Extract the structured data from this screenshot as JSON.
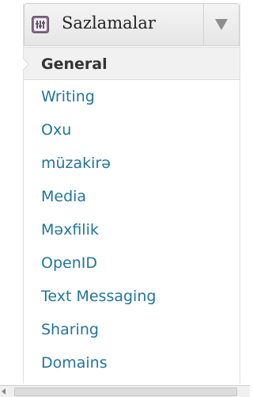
{
  "header": {
    "title": "Sazlamalar",
    "icon": "settings-icon"
  },
  "menu": {
    "items": [
      {
        "label": "General",
        "active": true
      },
      {
        "label": "Writing"
      },
      {
        "label": "Oxu"
      },
      {
        "label": "müzakirə"
      },
      {
        "label": "Media"
      },
      {
        "label": "Məxfilik"
      },
      {
        "label": "OpenID"
      },
      {
        "label": "Text Messaging"
      },
      {
        "label": "Sharing"
      },
      {
        "label": "Domains"
      }
    ]
  },
  "colors": {
    "link": "#21759b",
    "active_text": "#333333",
    "active_bg": "#f1f1f1"
  }
}
